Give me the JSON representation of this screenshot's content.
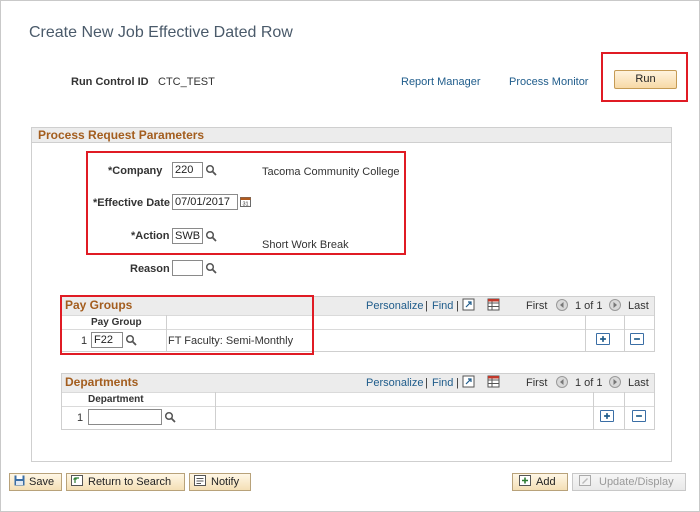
{
  "page": {
    "title": "Create New Job Effective Dated Row"
  },
  "run_control": {
    "label": "Run Control ID",
    "value": "CTC_TEST",
    "report_manager": "Report Manager",
    "process_monitor": "Process Monitor",
    "run_button": "Run"
  },
  "params": {
    "section_title": "Process Request Parameters",
    "company_label": "*Company",
    "company_value": "220",
    "company_desc": "Tacoma Community College",
    "effective_date_label": "*Effective Date",
    "effective_date_value": "07/01/2017",
    "action_label": "*Action",
    "action_value": "SWB",
    "action_desc": "Short Work Break",
    "reason_label": "Reason",
    "reason_value": ""
  },
  "pay_groups": {
    "title": "Pay Groups",
    "personalize": "Personalize",
    "sep": "|",
    "find": "Find",
    "first": "First",
    "range": "1 of 1",
    "last": "Last",
    "col_header": "Pay Group",
    "row_num": "1",
    "row_value": "F22",
    "row_desc": "FT Faculty: Semi-Monthly"
  },
  "departments": {
    "title": "Departments",
    "personalize": "Personalize",
    "sep": "|",
    "find": "Find",
    "first": "First",
    "range": "1 of 1",
    "last": "Last",
    "col_header": "Department",
    "row_num": "1",
    "row_value": ""
  },
  "toolbar": {
    "save": "Save",
    "return_to_search": "Return to Search",
    "notify": "Notify",
    "add": "Add",
    "update_display": "Update/Display"
  },
  "colors": {
    "title": "#4a5a6a",
    "section": "#a35d1e",
    "link": "#1f5c8b",
    "highlight": "#e01b24"
  }
}
